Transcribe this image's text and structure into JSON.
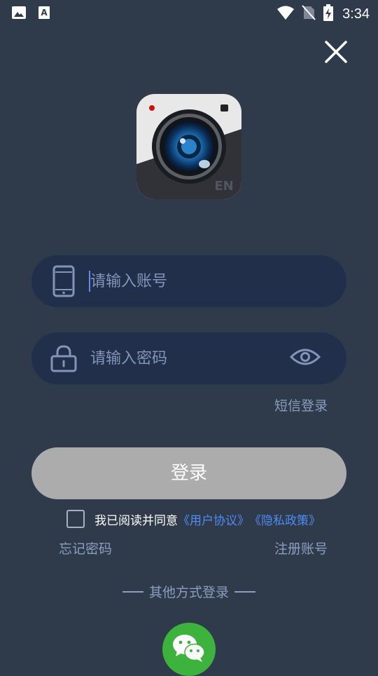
{
  "status_bar": {
    "time": "3:34",
    "icons": [
      "gallery-icon",
      "font-icon",
      "wifi-icon",
      "no-sim-icon",
      "battery-charging-icon"
    ]
  },
  "header": {
    "close_icon": "close-icon"
  },
  "logo": {
    "badge_text": "EN"
  },
  "form": {
    "account_placeholder": "请输入账号",
    "account_value": "",
    "password_placeholder": "请输入密码",
    "password_value": "",
    "sms_login_label": "短信登录",
    "login_label": "登录"
  },
  "agreement": {
    "checked": false,
    "text": "我已阅读并同意",
    "user_agreement": "《用户协议》",
    "privacy_policy": "《隐私政策》"
  },
  "links": {
    "forgot_password": "忘记密码",
    "register": "注册账号"
  },
  "other_login": {
    "label": "其他方式登录",
    "wechat_icon": "wechat-icon"
  },
  "colors": {
    "background": "#2f3b4b",
    "input_background": "#222f4a",
    "login_button": "#acacac",
    "link_blue": "#4d8bf5",
    "secondary_text": "#8e9cbf",
    "wechat_green": "#3db23c"
  }
}
